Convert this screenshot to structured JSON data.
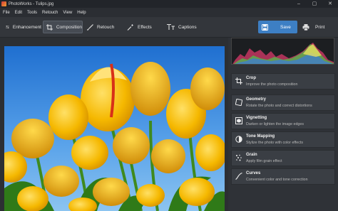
{
  "window": {
    "title": "PhotoWorks - Tulips.jpg",
    "controls": [
      "–",
      "▢",
      "✕"
    ]
  },
  "menu": [
    "File",
    "Edit",
    "Tools",
    "Retouch",
    "View",
    "Help"
  ],
  "tabs": [
    {
      "label": "Enhancement",
      "icon": "sliders-icon"
    },
    {
      "label": "Composition",
      "icon": "crop-icon",
      "active": true
    },
    {
      "label": "Retouch",
      "icon": "brush-icon"
    },
    {
      "label": "Effects",
      "icon": "magic-wand-icon"
    },
    {
      "label": "Captions",
      "icon": "text-icon"
    }
  ],
  "actions": {
    "save": "Save",
    "print": "Print"
  },
  "tools": [
    {
      "name": "Crop",
      "desc": "Improve the photo composition",
      "icon": "crop-icon"
    },
    {
      "name": "Geometry",
      "desc": "Rotate the photo and correct distortions",
      "icon": "geometry-icon"
    },
    {
      "name": "Vignetting",
      "desc": "Darken or lighten the image edges",
      "icon": "vignette-icon"
    },
    {
      "name": "Tone Mapping",
      "desc": "Stylize the photo with color effects",
      "icon": "tone-mapping-icon"
    },
    {
      "name": "Grain",
      "desc": "Apply film grain effect",
      "icon": "grain-icon"
    },
    {
      "name": "Curves",
      "desc": "Convenient color and tone correction",
      "icon": "curves-icon"
    }
  ],
  "colors": {
    "accent": "#3d7fc4",
    "panel": "#2f3237",
    "toolbar": "#33363b"
  }
}
